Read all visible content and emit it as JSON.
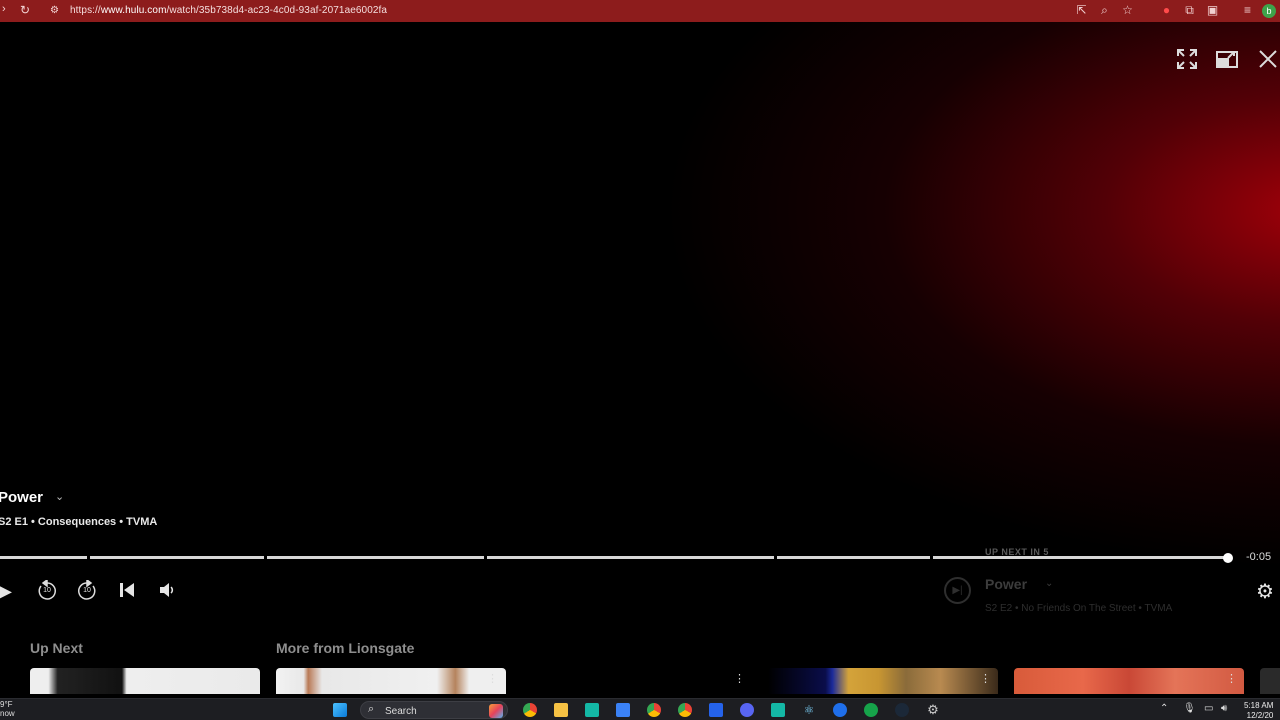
{
  "browser": {
    "url_prefix": "https://",
    "url_domain": "www.hulu.com",
    "url_path": "/watch/35b738d4-ac23-4c0d-93af-2071ae6002fa",
    "profile_initial": "b"
  },
  "player": {
    "show_title": "Power",
    "episode_meta": "S2 E1 • Consequences • TVMA",
    "time_remaining": "-0:05",
    "progress_fraction": 0.996,
    "skip_back_seconds": "10",
    "skip_forward_seconds": "10",
    "up_next": {
      "countdown_label": "UP NEXT IN 5",
      "title": "Power",
      "meta": "S2 E2 • No Friends On The Street • TVMA"
    }
  },
  "rows": {
    "up_next_label": "Up Next",
    "more_from_label": "More from Lionsgate"
  },
  "taskbar": {
    "weather_temp": "9°F",
    "weather_sub": "now",
    "search_label": "Search",
    "time": "5:18 AM",
    "date": "12/2/20"
  },
  "colors": {
    "browser_bar": "#8d1c1c",
    "video_glow": "#aa000a",
    "background": "#000000"
  }
}
